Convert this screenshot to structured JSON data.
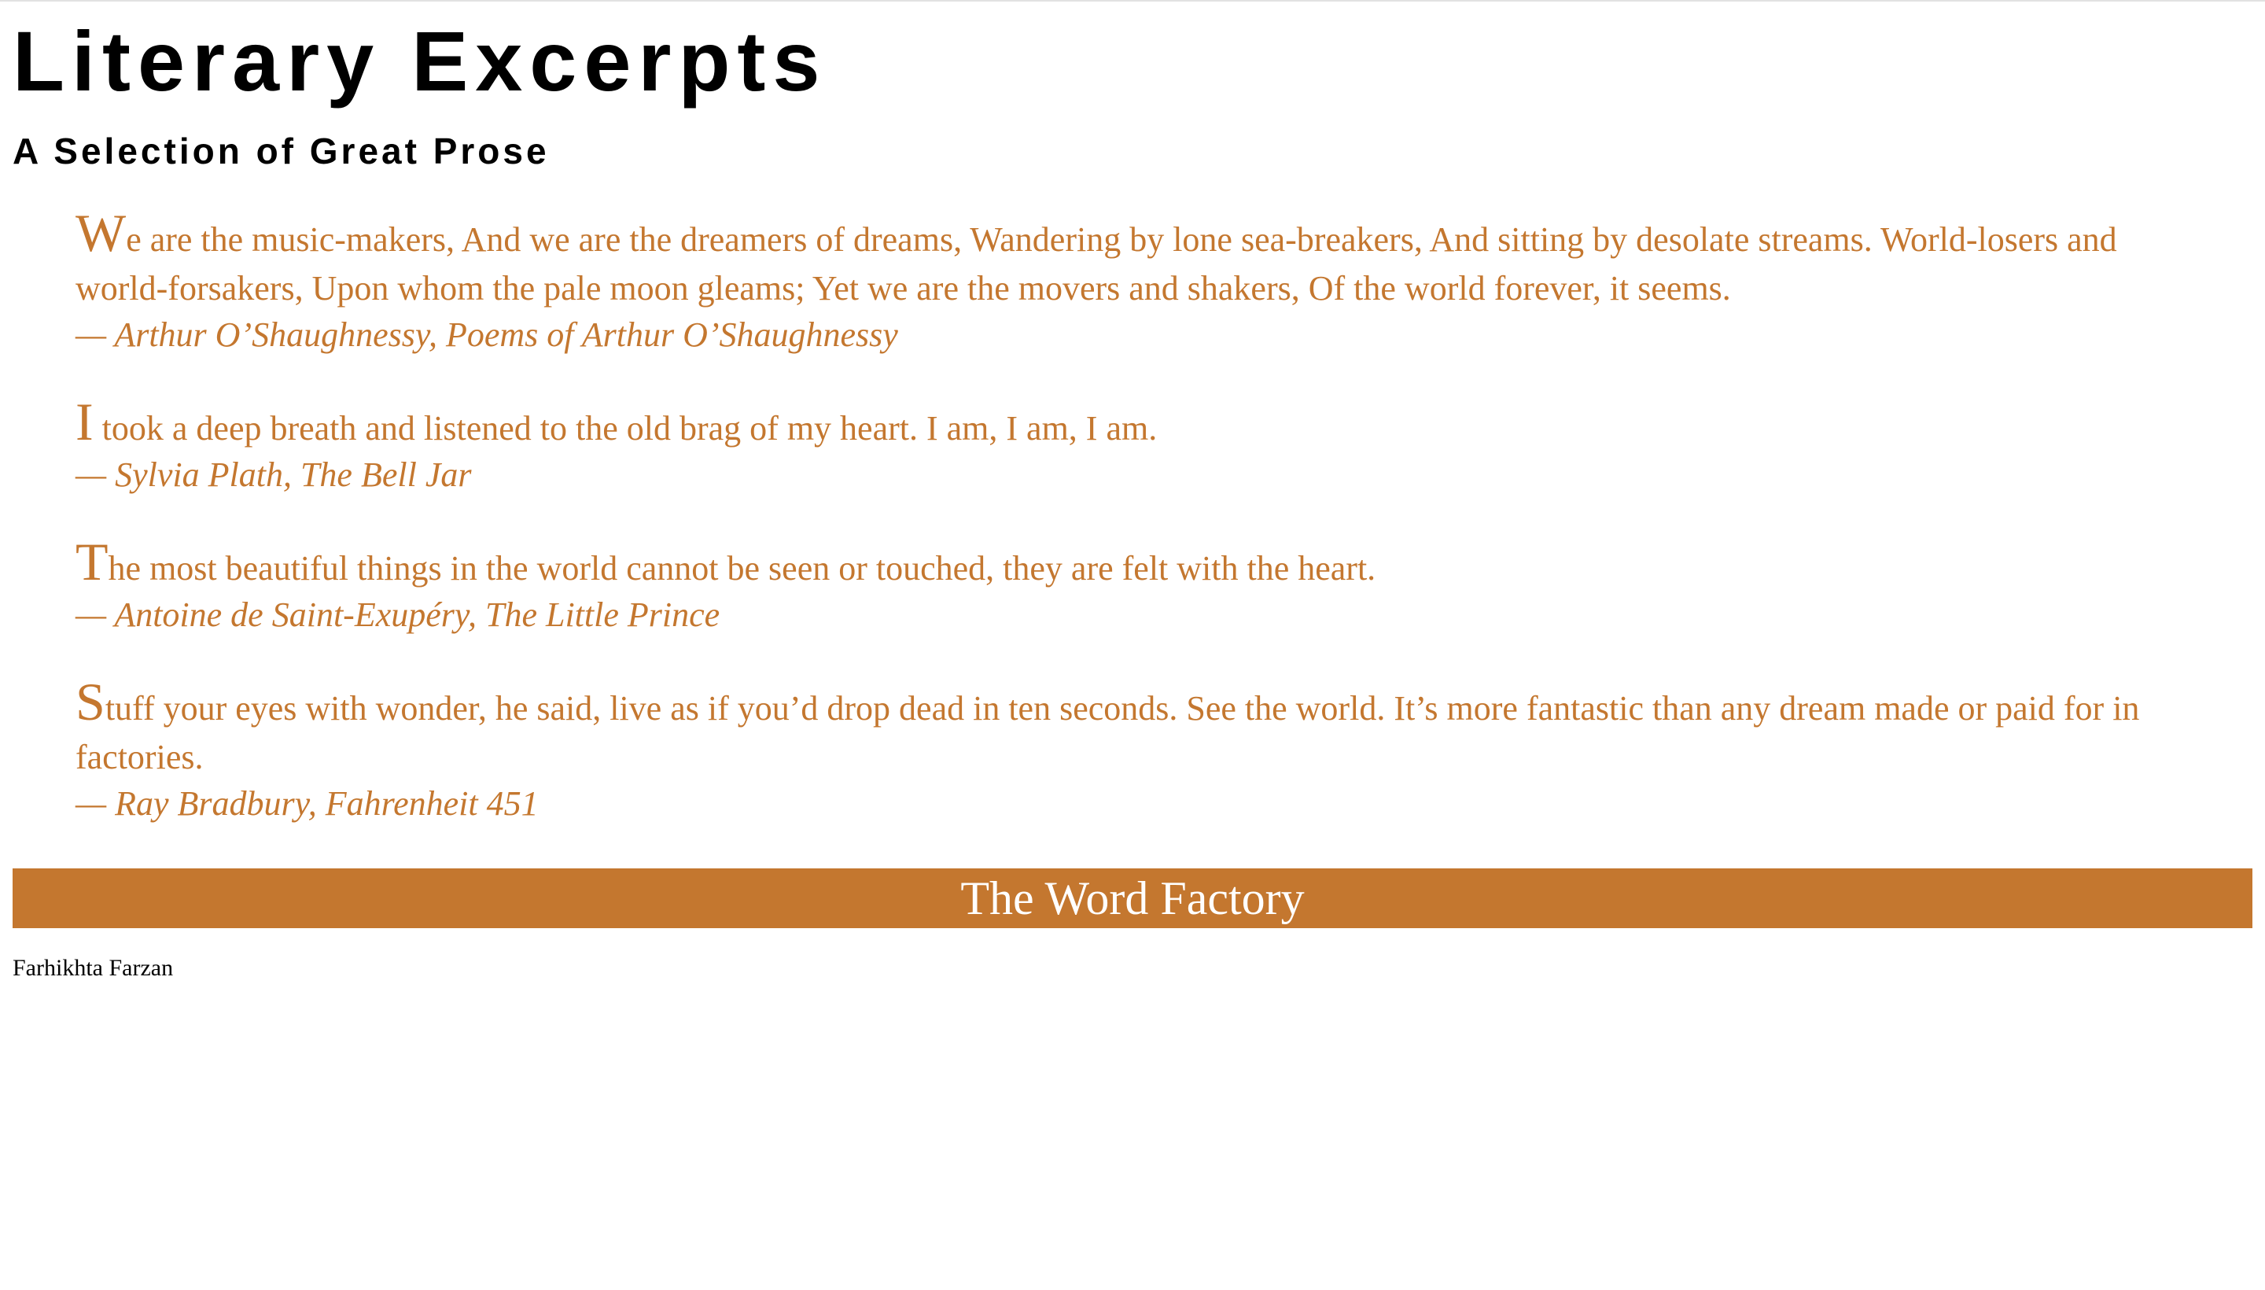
{
  "header": {
    "title": "Literary Excerpts",
    "subtitle": "A Selection of Great Prose"
  },
  "quotes": [
    {
      "first_letter": "W",
      "text": "e are the music-makers, And we are the dreamers of dreams, Wandering by lone sea-breakers, And sitting by desolate streams. World-losers and world-forsakers, Upon whom the pale moon gleams; Yet we are the movers and shakers, Of the world forever, it seems.",
      "attribution": "— Arthur O’Shaughnessy, Poems of Arthur O’Shaughnessy"
    },
    {
      "first_letter": "I",
      "text": " took a deep breath and listened to the old brag of my heart. I am, I am, I am.",
      "attribution": "— Sylvia Plath, The Bell Jar"
    },
    {
      "first_letter": "T",
      "text": "he most beautiful things in the world cannot be seen or touched, they are felt with the heart.",
      "attribution": "— Antoine de Saint-Exupéry, The Little Prince"
    },
    {
      "first_letter": "S",
      "text": "tuff your eyes with wonder, he said, live as if you’d drop dead in ten seconds. See the world. It’s more fantastic than any dream made or paid for in factories.",
      "attribution": "— Ray Bradbury, Fahrenheit 451"
    }
  ],
  "banner": {
    "text": "The Word Factory"
  },
  "footer": {
    "author": "Farhikhta Farzan"
  },
  "colors": {
    "accent": "#c4772f",
    "text": "#000000",
    "background": "#ffffff"
  }
}
